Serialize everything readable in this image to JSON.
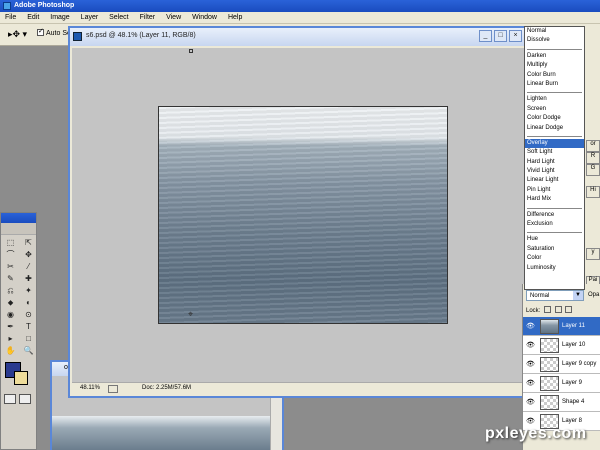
{
  "app": {
    "title": "Adobe Photoshop"
  },
  "menu": [
    "File",
    "Edit",
    "Image",
    "Layer",
    "Select",
    "Filter",
    "View",
    "Window",
    "Help"
  ],
  "options_bar": {
    "auto_select_label": "Auto Se"
  },
  "document": {
    "title": "s6.psd @ 48.1% (Layer 11, RGB/8)",
    "win_buttons": [
      "_",
      "□",
      "×"
    ],
    "status_zoom": "48.11%",
    "status_doc": "Doc: 2.25M/57.6M"
  },
  "document2": {
    "title": "o"
  },
  "tools": [
    "⬚",
    "⇱",
    "⌒",
    "✥",
    "✂",
    "⁄",
    "✎",
    "✚",
    "⎌",
    "✦",
    "⬥",
    "◐",
    "◉",
    "⊙",
    "✒",
    "T",
    "▸",
    "□",
    "✋",
    "🔍"
  ],
  "colors": {
    "foreground": "#2a3a8e",
    "background": "#eedc9a",
    "selection": "#316ac5"
  },
  "blend_modes": {
    "groups": [
      [
        "Normal",
        "Dissolve"
      ],
      [
        "Darken",
        "Multiply",
        "Color Burn",
        "Linear Burn"
      ],
      [
        "Lighten",
        "Screen",
        "Color Dodge",
        "Linear Dodge"
      ],
      [
        "Overlay",
        "Soft Light",
        "Hard Light",
        "Vivid Light",
        "Linear Light",
        "Pin Light",
        "Hard Mix"
      ],
      [
        "Difference",
        "Exclusion"
      ],
      [
        "Hue",
        "Saturation",
        "Color",
        "Luminosity"
      ]
    ],
    "selected": "Overlay"
  },
  "layers_panel": {
    "blend_value": "Normal",
    "opacity_label": "Opa",
    "lock_label": "Lock:",
    "layers": [
      {
        "name": "Layer 11",
        "active": true
      },
      {
        "name": "Layer 10",
        "active": false
      },
      {
        "name": "Layer 9 copy",
        "active": false
      },
      {
        "name": "Layer 9",
        "active": false
      },
      {
        "name": "Shape 4",
        "active": false
      },
      {
        "name": "Layer 8",
        "active": false
      }
    ]
  },
  "right_panel_tabs": [
    "or",
    "R",
    "G",
    "Hi",
    "y",
    "Pai"
  ],
  "watermark": "pxleyes.com"
}
